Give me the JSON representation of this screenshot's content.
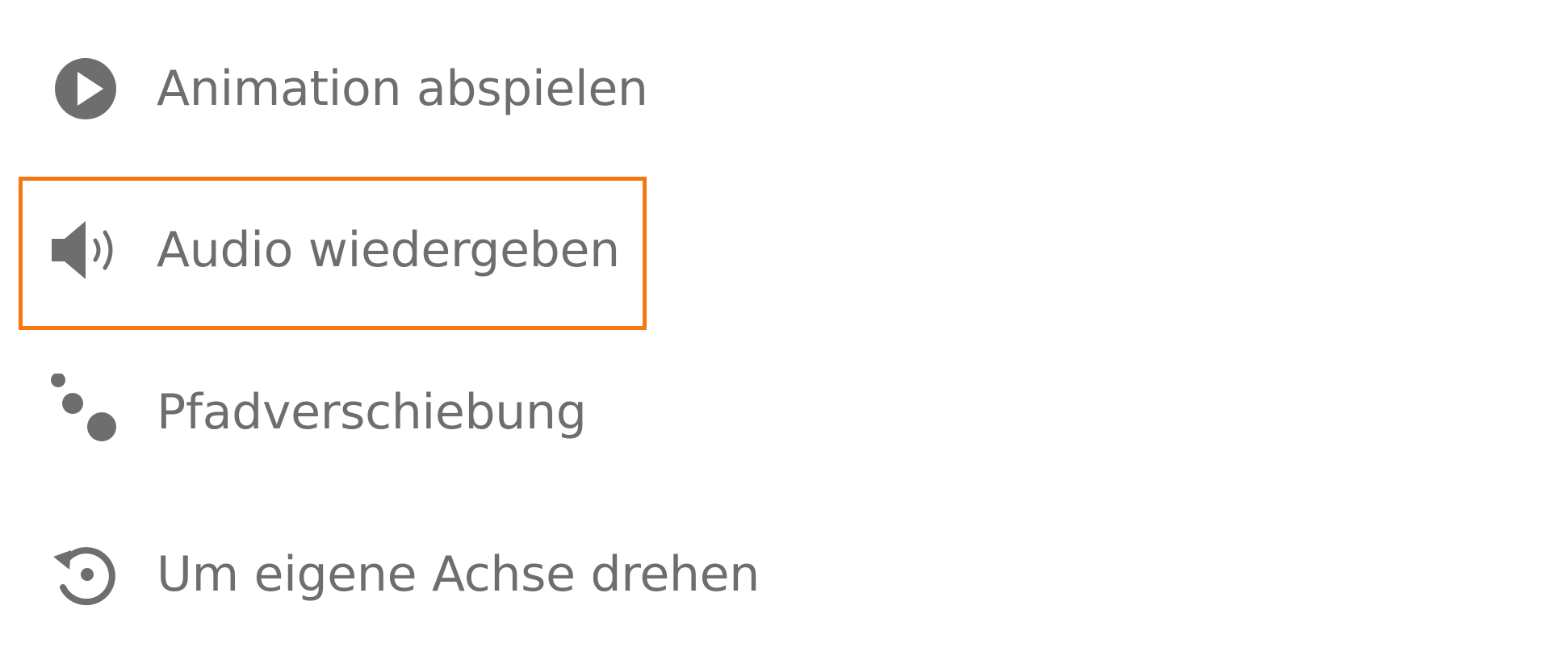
{
  "menu": {
    "items": [
      {
        "label": "Animation abspielen",
        "icon": "play-circle-icon"
      },
      {
        "label": "Audio wiedergeben",
        "icon": "speaker-icon"
      },
      {
        "label": "Pfadverschiebung",
        "icon": "path-dots-icon"
      },
      {
        "label": "Um eigene Achse drehen",
        "icon": "rotate-icon"
      }
    ],
    "selected_index": 1
  },
  "colors": {
    "text": "#6e6e6e",
    "icon": "#6e6e6e",
    "highlight": "#f4790f",
    "background": "#ffffff"
  }
}
